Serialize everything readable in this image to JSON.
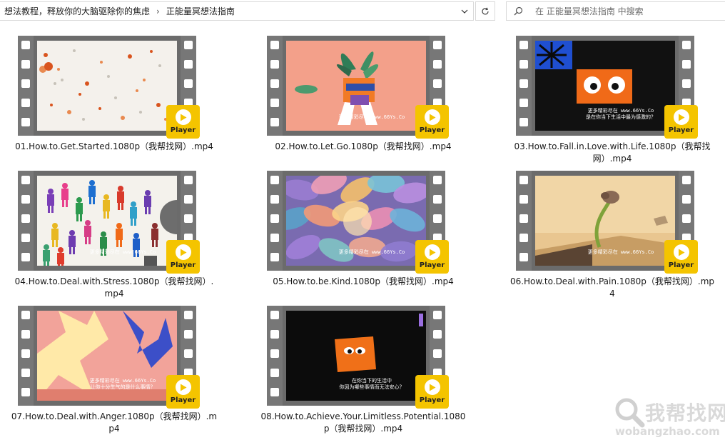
{
  "address_bar": {
    "crumbs": [
      "想法教程，释放你的大脑驱除你的焦虑",
      "正能量冥想法指南"
    ],
    "separator": "›"
  },
  "search": {
    "placeholder": "在 正能量冥想法指南 中搜索"
  },
  "files": [
    {
      "name": "01.How.to.Get.Started.1080p（我帮找网）.mp4",
      "badge": "Player",
      "caption": ""
    },
    {
      "name": "02.How.to.Let.Go.1080p（我帮找网）.mp4",
      "badge": "Player",
      "caption": "更多精彩尽在 www.66Ys.Co"
    },
    {
      "name": "03.How.to.Fall.in.Love.with.Life.1080p（我帮找网）.mp4",
      "badge": "Player",
      "caption": "更多精彩尽在 www.66Ys.Co\n是在你当下生活中最为感激的？"
    },
    {
      "name": "04.How.to.Deal.with.Stress.1080p（我帮找网）.mp4",
      "badge": "Player",
      "caption": "更多精彩尽在 www.66Ys.Co"
    },
    {
      "name": "05.How.to.be.Kind.1080p（我帮找网）.mp4",
      "badge": "Player",
      "caption": "更多精彩尽在 www.66Ys.Co"
    },
    {
      "name": "06.How.to.Deal.with.Pain.1080p（我帮找网）.mp4",
      "badge": "Player",
      "caption": "更多精彩尽在 www.66Ys.Co"
    },
    {
      "name": "07.How.to.Deal.with.Anger.1080p（我帮找网）.mp4",
      "badge": "Player",
      "caption": "更多精彩尽在 www.66Ys.Co\n让你十分生气的是什么事情？"
    },
    {
      "name": "08.How.to.Achieve.Your.Limitless.Potential.1080p（我帮找网）.mp4",
      "badge": "Player",
      "caption": "在你当下的生活中\n你因为哪些事情而无法安心？"
    }
  ],
  "watermark": {
    "text": "我帮找网",
    "url": "wobangzhao.com"
  },
  "colors": {
    "badge": "#f4c400",
    "film": "#6b6b6b"
  }
}
